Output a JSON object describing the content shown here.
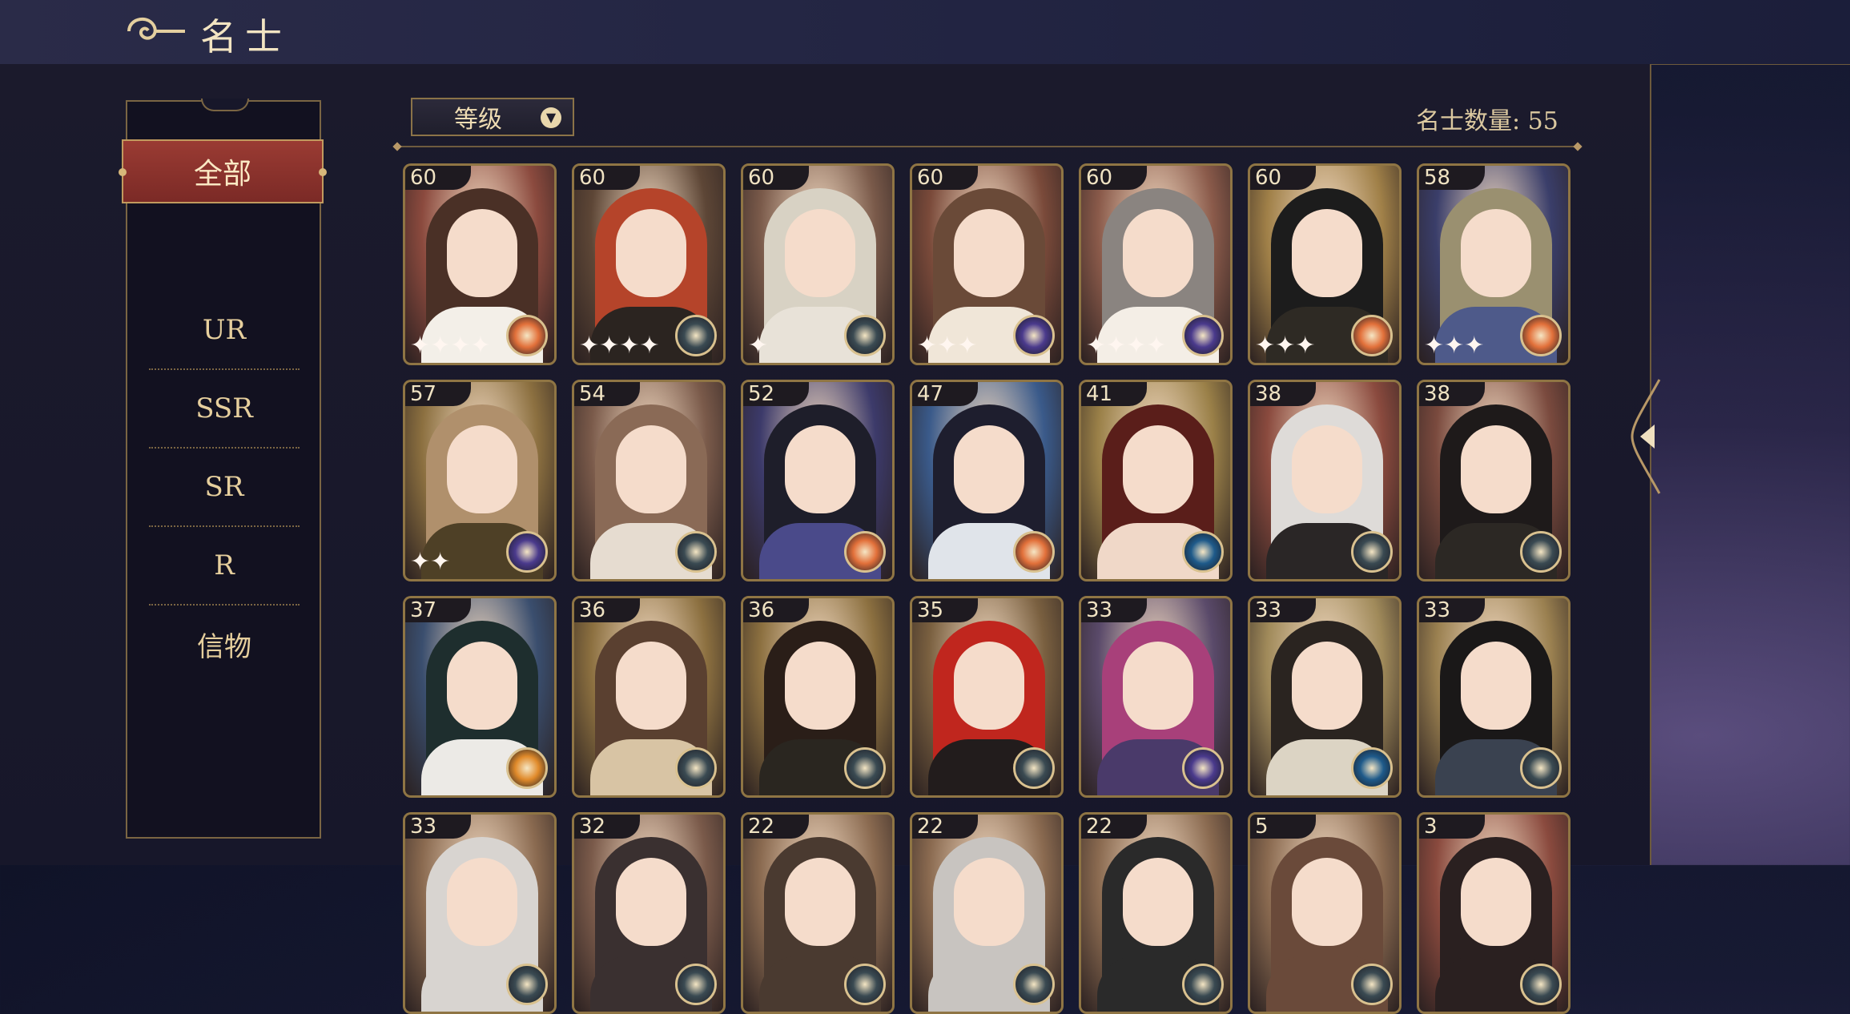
{
  "header": {
    "title": "名士"
  },
  "filter": {
    "items": [
      "全部",
      "UR",
      "SSR",
      "SR",
      "R",
      "信物"
    ],
    "active": "全部"
  },
  "sort": {
    "label": "等级"
  },
  "count_label": "名士数量: 55",
  "cards": [
    {
      "level": "60",
      "bg": "#8b4a3e",
      "hair": "#4a3026",
      "body": "#f3efe8",
      "badge": "#e2703a",
      "stars": "✦✦✦✦"
    },
    {
      "level": "60",
      "bg": "#5d4636",
      "hair": "#b5442a",
      "body": "#2b2420",
      "badge": "#3a4a52",
      "stars": "✦✦✦✦"
    },
    {
      "level": "60",
      "bg": "#7a5a4a",
      "hair": "#d8d2c4",
      "body": "#e8e2d8",
      "badge": "#3a4a52",
      "stars": "✦"
    },
    {
      "level": "60",
      "bg": "#7a4a3a",
      "hair": "#6a4a38",
      "body": "#f0e6d8",
      "badge": "#4a3a8c",
      "stars": "✦✦✦"
    },
    {
      "level": "60",
      "bg": "#8a5a4a",
      "hair": "#8a8480",
      "body": "#f4eee6",
      "badge": "#4a3a8c",
      "stars": "✦✦✦✦"
    },
    {
      "level": "60",
      "bg": "#a08048",
      "hair": "#1c1c1c",
      "body": "#2e2a24",
      "badge": "#e2703a",
      "stars": "✦✦✦"
    },
    {
      "level": "58",
      "bg": "#3a3e6a",
      "hair": "#9a9070",
      "body": "#4e5a8a",
      "badge": "#e2703a",
      "stars": "✦✦✦"
    },
    {
      "level": "57",
      "bg": "#8c7040",
      "hair": "#b0906c",
      "body": "#4e4026",
      "badge": "#4a3a8c",
      "stars": "✦✦"
    },
    {
      "level": "54",
      "bg": "#7a5a4a",
      "hair": "#8a6a56",
      "body": "#e6dcd0",
      "badge": "#3a4a52",
      "stars": ""
    },
    {
      "level": "52",
      "bg": "#3c3a6a",
      "hair": "#1e1e2a",
      "body": "#4a4a8a",
      "badge": "#e2703a",
      "stars": ""
    },
    {
      "level": "47",
      "bg": "#3a5a8a",
      "hair": "#1e1e2e",
      "body": "#e0e4ea",
      "badge": "#e2703a",
      "stars": ""
    },
    {
      "level": "41",
      "bg": "#9a8048",
      "hair": "#5a1e1a",
      "body": "#f0d8c8",
      "badge": "#1e5a8a",
      "stars": ""
    },
    {
      "level": "38",
      "bg": "#8a4a3e",
      "hair": "#dedbd8",
      "body": "#2a2626",
      "badge": "#3a4a52",
      "stars": ""
    },
    {
      "level": "38",
      "bg": "#7a4a3e",
      "hair": "#1e1a1a",
      "body": "#2c2824",
      "badge": "#3a4a52",
      "stars": ""
    },
    {
      "level": "37",
      "bg": "#3a4e6e",
      "hair": "#1e2e2e",
      "body": "#eceae6",
      "badge": "#e08a2a",
      "stars": ""
    },
    {
      "level": "36",
      "bg": "#8c7040",
      "hair": "#5a4030",
      "body": "#d8c4a4",
      "badge": "#3a4a52",
      "stars": ""
    },
    {
      "level": "36",
      "bg": "#8c7040",
      "hair": "#2a1e18",
      "body": "#2a2620",
      "badge": "#3a4a52",
      "stars": ""
    },
    {
      "level": "35",
      "bg": "#7a6040",
      "hair": "#c0261e",
      "body": "#221c1c",
      "badge": "#3a4a52",
      "stars": ""
    },
    {
      "level": "33",
      "bg": "#5a4a6a",
      "hair": "#a8407a",
      "body": "#4a3a6a",
      "badge": "#4a3a8c",
      "stars": ""
    },
    {
      "level": "33",
      "bg": "#a08a5a",
      "hair": "#2a2420",
      "body": "#dcd4c4",
      "badge": "#1e5a8a",
      "stars": ""
    },
    {
      "level": "33",
      "bg": "#9a8050",
      "hair": "#1a1818",
      "body": "#3a4250",
      "badge": "#3a4a52",
      "stars": ""
    },
    {
      "level": "33",
      "bg": "#8a6a50",
      "hair": "#d8d4d0",
      "body": "#d8d4d0",
      "badge": "#3a4a52",
      "stars": ""
    },
    {
      "level": "32",
      "bg": "#7a5a4a",
      "hair": "#3a3030",
      "body": "#3a3030",
      "badge": "#3a4a52",
      "stars": ""
    },
    {
      "level": "22",
      "bg": "#8a6a50",
      "hair": "#4a3a30",
      "body": "#4a3a30",
      "badge": "#3a4a52",
      "stars": ""
    },
    {
      "level": "22",
      "bg": "#8a6a50",
      "hair": "#c8c4c0",
      "body": "#c8c4c0",
      "badge": "#3a4a52",
      "stars": ""
    },
    {
      "level": "22",
      "bg": "#8a6a50",
      "hair": "#2a2a2a",
      "body": "#2a2a2a",
      "badge": "#3a4a52",
      "stars": ""
    },
    {
      "level": "5",
      "bg": "#8a6a50",
      "hair": "#6a4a3a",
      "body": "#6a4a3a",
      "badge": "#3a4a52",
      "stars": ""
    },
    {
      "level": "3",
      "bg": "#8a4a3e",
      "hair": "#2a2020",
      "body": "#2a2020",
      "badge": "#3a4a52",
      "stars": ""
    }
  ]
}
